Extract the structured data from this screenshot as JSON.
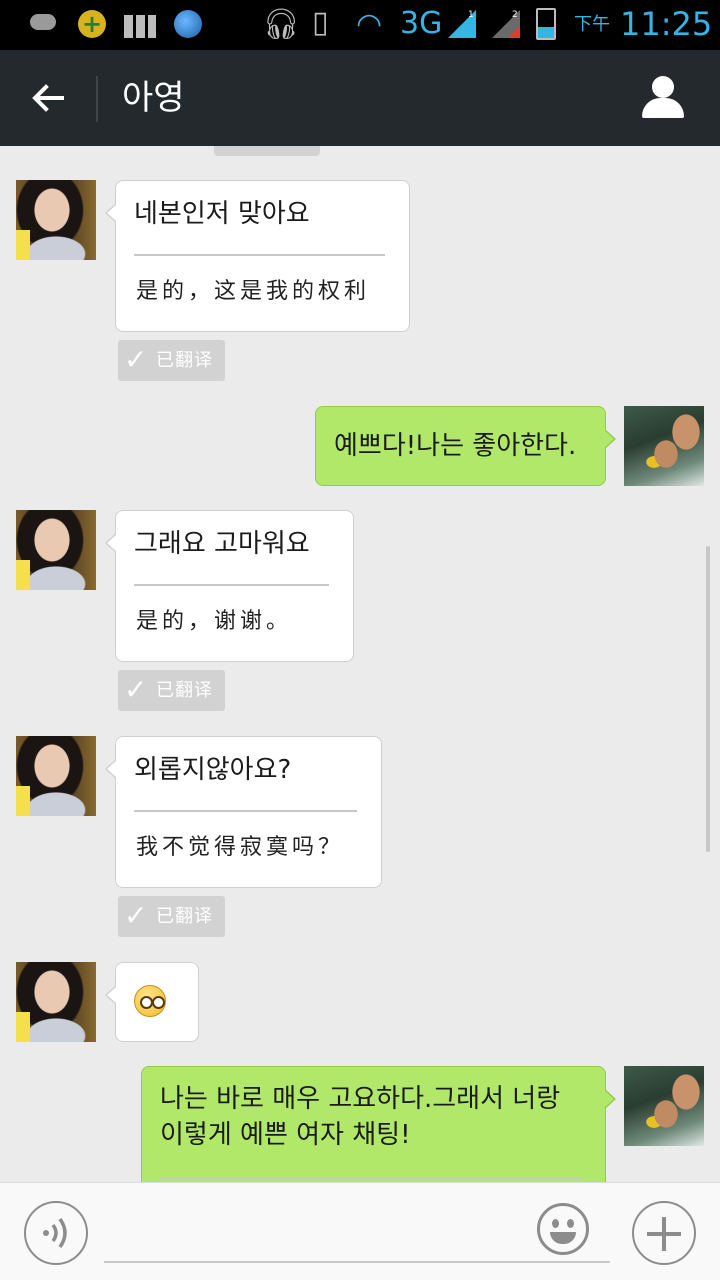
{
  "status_bar": {
    "network": "3G",
    "sim1_label": "1",
    "sim2_label": "2",
    "ampm": "下午",
    "time": "11:25"
  },
  "header": {
    "back_icon": "arrow-left-icon",
    "title": "아영",
    "profile_icon": "person-icon",
    "background": "#23292d"
  },
  "messages": [
    {
      "from": "contact",
      "text": "네본인저 맞아요",
      "translation": "是的，这是我的权利",
      "translated": true
    },
    {
      "from": "me",
      "text": "예쁘다!나는 좋아한다."
    },
    {
      "from": "contact",
      "text": "그래요  고마워요",
      "translation": "是的，谢谢。",
      "translated": true
    },
    {
      "from": "contact",
      "text": "외롭지않아요?",
      "translation": "我不觉得寂寞吗？",
      "translated": true
    },
    {
      "from": "contact",
      "emoji": "flushed-face-emoji"
    },
    {
      "from": "me",
      "lines": [
        "나는 바로 매우 고요하다.그래서 너랑",
        "이렇게 예쁜 여자 채팅!"
      ]
    }
  ],
  "translated_badge": "已翻译",
  "input_bar": {
    "voice_icon": "voice-icon",
    "text_value": "",
    "emoji_icon": "smiley-icon",
    "plus_icon": "plus-icon"
  },
  "colors": {
    "incoming_bubble": "#ffffff",
    "outgoing_bubble": "#b2e86a",
    "chat_background": "#ebebeb",
    "status_accent": "#33b5e5"
  }
}
